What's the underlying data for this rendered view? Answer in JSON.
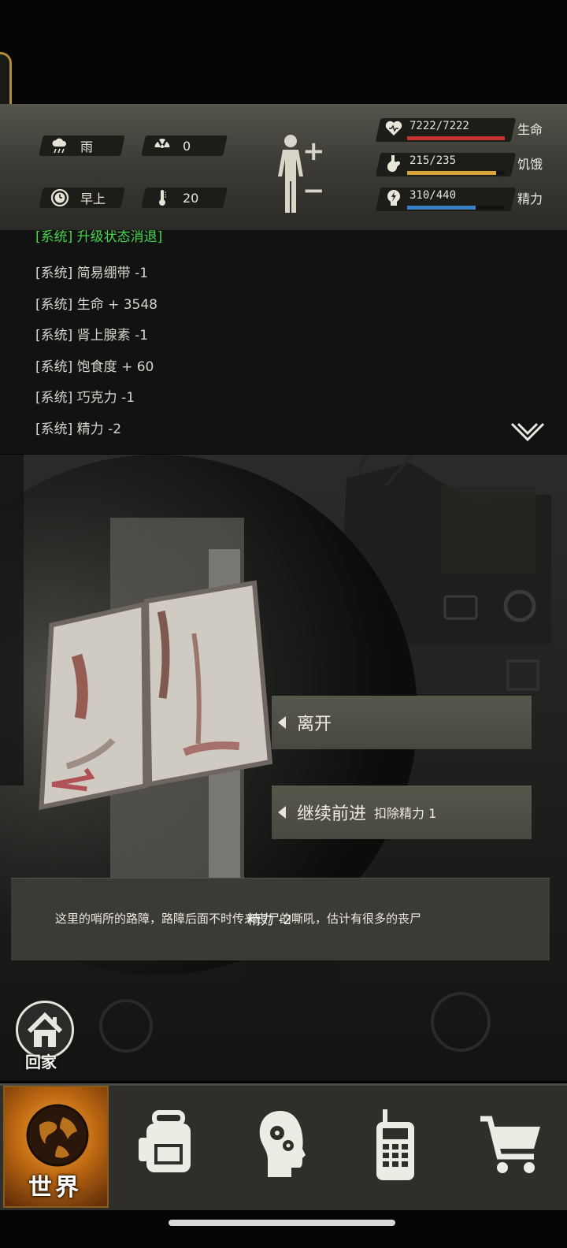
{
  "status": {
    "weather": {
      "icon": "rain-cloud-icon",
      "label": "雨"
    },
    "radiation": {
      "icon": "radiation-icon",
      "value": "0"
    },
    "time_of_day": {
      "icon": "clock-icon",
      "label": "早上"
    },
    "temperature": {
      "icon": "thermometer-icon",
      "value": "20"
    },
    "vitals": [
      {
        "name": "生命",
        "value": "7222/7222",
        "icon": "heart-icon",
        "fill": 1.0,
        "color": "#c8322e"
      },
      {
        "name": "饥饿",
        "value": "215/235",
        "icon": "stomach-icon",
        "fill": 0.915,
        "color": "#d8a338"
      },
      {
        "name": "精力",
        "value": "310/440",
        "icon": "energy-icon",
        "fill": 0.705,
        "color": "#3b7fc4"
      }
    ]
  },
  "log": {
    "partial_line": "[系统] 升级状态消退]",
    "lines": [
      "[系统] 简易绷带 -1",
      "[系统] 生命 + 3548",
      "[系统] 肾上腺素 -1",
      "[系统] 饱食度 + 60",
      "[系统] 巧克力 -1",
      "[系统] 精力 -2"
    ]
  },
  "choices": [
    {
      "label": "离开",
      "sub": ""
    },
    {
      "label": "继续前进",
      "sub": "扣除精力 1"
    }
  ],
  "message": {
    "text": "这里的哨所的路障，路障后面不时传来丧尸的嘶吼，估计有很多的丧尸",
    "overlay": "精力 -2"
  },
  "home_button": {
    "label": "回家"
  },
  "nav": {
    "world_label": "世界",
    "items": [
      "world-globe-icon",
      "backpack-icon",
      "head-gears-icon",
      "walkie-talkie-icon",
      "shopping-cart-icon"
    ]
  }
}
